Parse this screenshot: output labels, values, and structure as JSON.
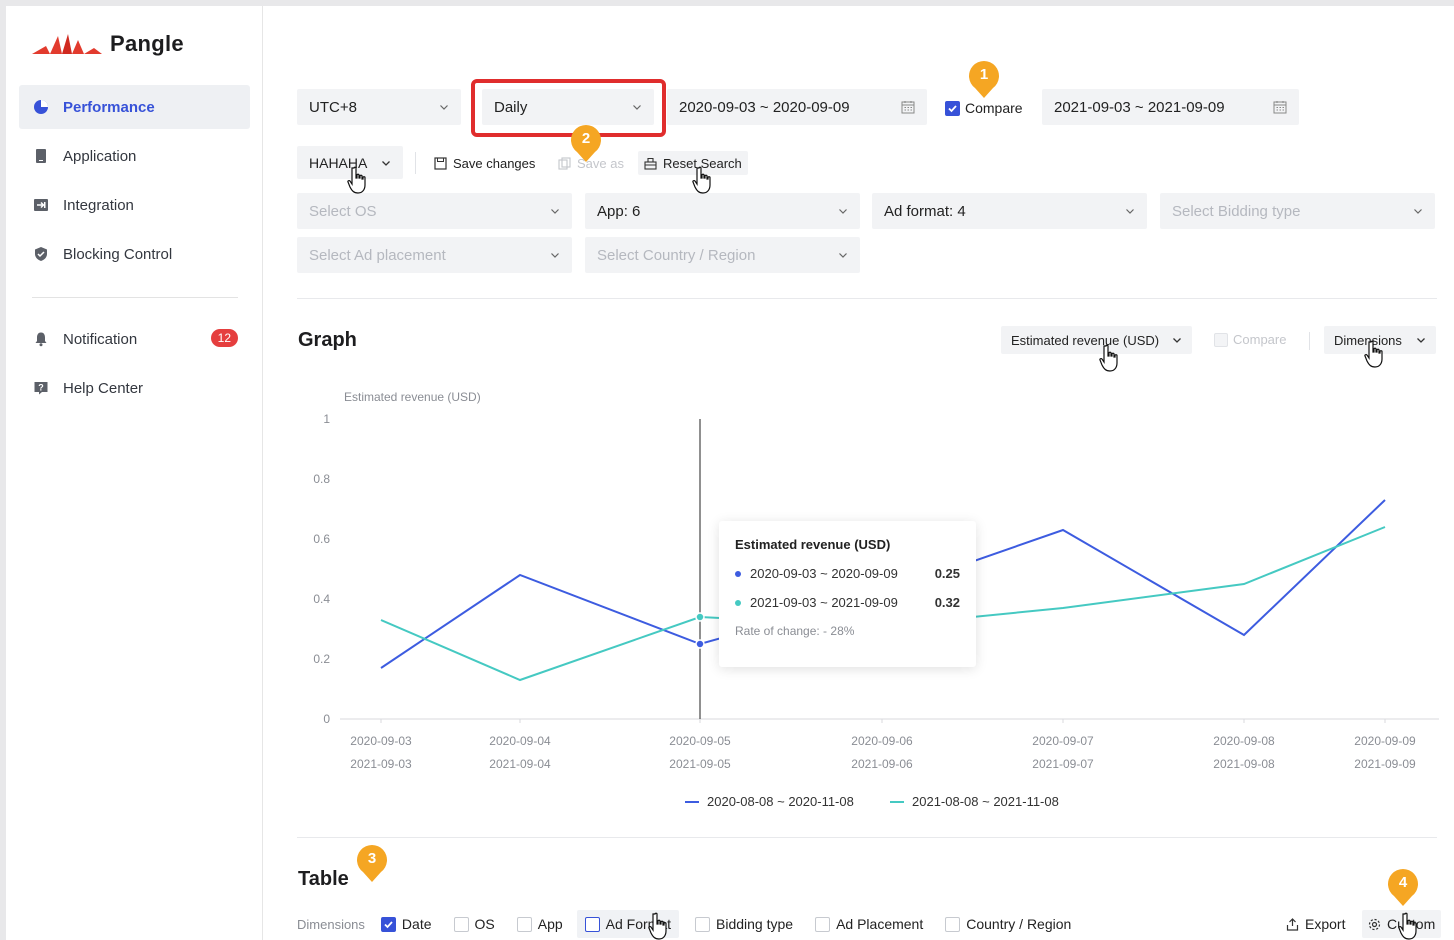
{
  "brand": {
    "name": "Pangle"
  },
  "sidebar": {
    "items": [
      {
        "label": "Performance",
        "icon": "pie-chart-icon",
        "active": true
      },
      {
        "label": "Application",
        "icon": "phone-icon"
      },
      {
        "label": "Integration",
        "icon": "integration-icon"
      },
      {
        "label": "Blocking Control",
        "icon": "shield-icon"
      }
    ],
    "secondary": [
      {
        "label": "Notification",
        "icon": "bell-icon",
        "badge": "12"
      },
      {
        "label": "Help Center",
        "icon": "help-icon"
      }
    ]
  },
  "filters": {
    "timezone": "UTC+8",
    "granularity": "Daily",
    "date_range": "2020-09-03 ~ 2020-09-09",
    "compare_label": "Compare",
    "compare_checked": true,
    "compare_range": "2021-09-03 ~ 2021-09-09",
    "preset": "HAHAHA",
    "save_changes": "Save changes",
    "save_as": "Save as",
    "reset_search": "Reset Search",
    "os_placeholder": "Select OS",
    "app": "App: 6",
    "ad_format": "Ad format: 4",
    "bidding_placeholder": "Select Bidding type",
    "placement_placeholder": "Select Ad placement",
    "country_placeholder": "Select Country / Region"
  },
  "markers": [
    "1",
    "2",
    "3",
    "4"
  ],
  "graph": {
    "title": "Graph",
    "metric": "Estimated revenue (USD)",
    "compare_label": "Compare",
    "dimensions_label": "Dimensions"
  },
  "chart_data": {
    "type": "line",
    "ylabel": "Estimated revenue (USD)",
    "ylim": [
      0,
      1
    ],
    "yticks": [
      "0",
      "0.2",
      "0.4",
      "0.6",
      "0.8",
      "1"
    ],
    "x": [
      "2020-09-03",
      "2020-09-04",
      "2020-09-05",
      "2020-09-06",
      "2020-09-07",
      "2020-09-08",
      "2020-09-09"
    ],
    "x_secondary": [
      "2021-09-03",
      "2021-09-04",
      "2021-09-05",
      "2021-09-06",
      "2021-09-07",
      "2021-09-08",
      "2021-09-09"
    ],
    "series": [
      {
        "name": "2020-08-08 ~ 2020-11-08",
        "color": "#3d5ce0",
        "values": [
          0.17,
          0.48,
          0.25,
          0.42,
          0.63,
          0.28,
          0.73
        ]
      },
      {
        "name": "2021-08-08 ~ 2021-11-08",
        "color": "#45c9c2",
        "values": [
          0.33,
          0.13,
          0.34,
          0.31,
          0.37,
          0.45,
          0.64
        ]
      }
    ],
    "tooltip": {
      "title": "Estimated revenue (USD)",
      "rows": [
        {
          "label": "2020-09-03 ~ 2020-09-09",
          "value": "0.25",
          "color": "#3d5ce0"
        },
        {
          "label": "2021-09-03 ~ 2021-09-09",
          "value": "0.32",
          "color": "#45c9c2"
        }
      ],
      "footer": "Rate of change: - 28%"
    },
    "legend": "bottom-center",
    "highlight_index": 2
  },
  "table": {
    "title": "Table",
    "dimensions_label": "Dimensions",
    "dims": [
      {
        "label": "Date",
        "checked": true
      },
      {
        "label": "OS",
        "checked": false
      },
      {
        "label": "App",
        "checked": false
      },
      {
        "label": "Ad Format",
        "checked": false,
        "highlight": true
      },
      {
        "label": "Bidding type",
        "checked": false
      },
      {
        "label": "Ad Placement",
        "checked": false
      },
      {
        "label": "Country / Region",
        "checked": false
      }
    ],
    "export": "Export",
    "custom": "Custom"
  }
}
